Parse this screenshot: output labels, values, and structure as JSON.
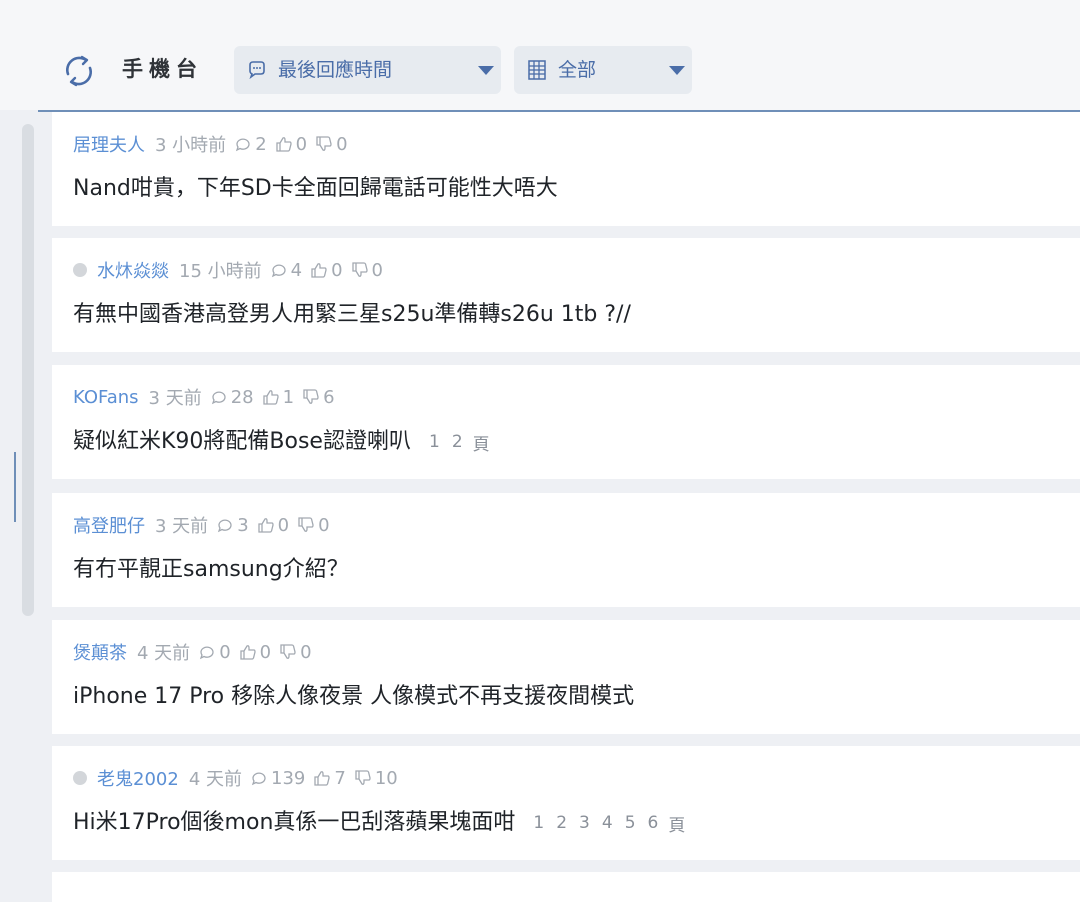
{
  "header": {
    "title": "手機台",
    "sort_dropdown": {
      "label": "最後回應時間",
      "icon": "chat-bubble-icon"
    },
    "filter_dropdown": {
      "label": "全部",
      "icon": "grid-filter-icon"
    },
    "refresh_icon": "refresh-icon",
    "colors": {
      "accent": "#4a6da8",
      "author": "#5b8fd4",
      "divider": "#6f8fb8"
    }
  },
  "threads": [
    {
      "author": "居理夫人",
      "time": "3 小時前",
      "replies": "2",
      "likes": "0",
      "dislikes": "0",
      "title": "Nand咁貴，下年SD卡全面回歸電話可能性大唔大",
      "has_dot": false,
      "pages": []
    },
    {
      "author": "水炑焱燚",
      "time": "15 小時前",
      "replies": "4",
      "likes": "0",
      "dislikes": "0",
      "title": "有無中國香港高登男人用緊三星s25u準備轉s26u 1tb ?//",
      "has_dot": true,
      "pages": []
    },
    {
      "author": "KOFans",
      "time": "3 天前",
      "replies": "28",
      "likes": "1",
      "dislikes": "6",
      "title": "疑似紅米K90將配備Bose認證喇叭",
      "has_dot": false,
      "pages": [
        "1",
        "2"
      ],
      "pages_suffix": "頁"
    },
    {
      "author": "高登肥仔",
      "time": "3 天前",
      "replies": "3",
      "likes": "0",
      "dislikes": "0",
      "title": "有冇平靚正samsung介紹？",
      "has_dot": false,
      "pages": []
    },
    {
      "author": "煲顛茶",
      "time": "4 天前",
      "replies": "0",
      "likes": "0",
      "dislikes": "0",
      "title": "iPhone 17 Pro 移除人像夜景 人像模式不再支援夜間模式",
      "has_dot": false,
      "pages": []
    },
    {
      "author": "老鬼2002",
      "time": "4 天前",
      "replies": "139",
      "likes": "7",
      "dislikes": "10",
      "title": "Hi米17Pro個後mon真係一巴刮落蘋果塊面咁",
      "has_dot": true,
      "pages": [
        "1",
        "2",
        "3",
        "4",
        "5",
        "6"
      ],
      "pages_suffix": "頁"
    }
  ]
}
